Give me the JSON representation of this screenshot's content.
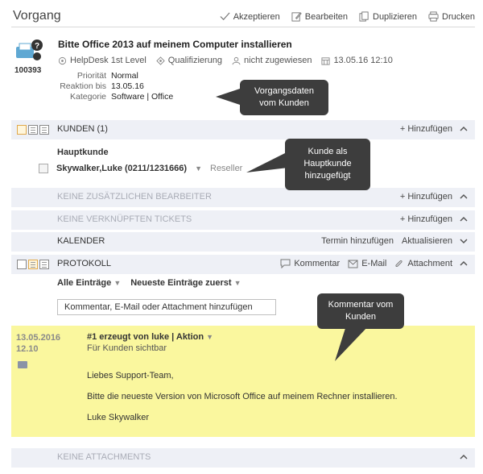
{
  "header": {
    "title": "Vorgang",
    "actions": [
      {
        "label": "Akzeptieren",
        "icon": "check-icon"
      },
      {
        "label": "Bearbeiten",
        "icon": "edit-icon"
      },
      {
        "label": "Duplizieren",
        "icon": "duplicate-icon"
      },
      {
        "label": "Drucken",
        "icon": "print-icon"
      }
    ]
  },
  "ticket": {
    "number": "100393",
    "title": "Bitte Office 2013 auf meinem Computer installieren",
    "meta": [
      {
        "label": "HelpDesk 1st Level",
        "icon": "group-icon"
      },
      {
        "label": "Qualifizierung",
        "icon": "status-icon"
      },
      {
        "label": "nicht zugewiesen",
        "icon": "user-icon"
      },
      {
        "label": "13.05.16 12:10",
        "icon": "calendar-icon"
      }
    ],
    "fields": [
      {
        "key": "Priorität",
        "value": "Normal"
      },
      {
        "key": "Reaktion bis",
        "value": "13.05.16"
      },
      {
        "key": "Kategorie",
        "value": "Software | Office"
      }
    ]
  },
  "sections": {
    "kunden": {
      "label": "Kunden (1)",
      "add": "+ Hinzufügen"
    },
    "bearbeiter": {
      "label": "Keine zusätzlichen Bearbeiter",
      "add": "+ Hinzufügen"
    },
    "tickets": {
      "label": "Keine verknüpften Tickets",
      "add": "+ Hinzufügen"
    },
    "kalender": {
      "label": "Kalender",
      "actions": [
        "Termin hinzufügen",
        "Aktualisieren"
      ]
    },
    "protokoll": {
      "label": "Protokoll",
      "actions": [
        "Kommentar",
        "E-Mail",
        "Attachment"
      ]
    },
    "attachments": {
      "label": "Keine Attachments"
    }
  },
  "customers": {
    "heading": "Hauptkunde",
    "name": "Skywalker,Luke (0211/1231666)",
    "role": "Reseller"
  },
  "protocol": {
    "filter": "Alle Einträge",
    "sort": "Neueste Einträge zuerst",
    "input_placeholder": "Kommentar, E-Mail oder Attachment hinzufügen",
    "entry": {
      "date": "13.05.2016",
      "time": "12.10",
      "head": "#1 erzeugt von luke | Aktion",
      "visibility": "Für Kunden sichtbar",
      "lines": [
        "Liebes Support-Team,",
        "Bitte die neueste Version von Microsoft Office auf meinem Rechner installieren.",
        "Luke Skywalker"
      ]
    }
  },
  "callouts": {
    "c1": [
      "Vorgangsdaten",
      "vom Kunden"
    ],
    "c2": [
      "Kunde als",
      "Hauptkunde",
      "hinzugefügt"
    ],
    "c3": [
      "Kommentar vom",
      "Kunden"
    ]
  },
  "colors": {
    "entry_bg": "#faf79e",
    "bar_bg": "#eef0f6",
    "callout_bg": "#3d3d3d"
  }
}
